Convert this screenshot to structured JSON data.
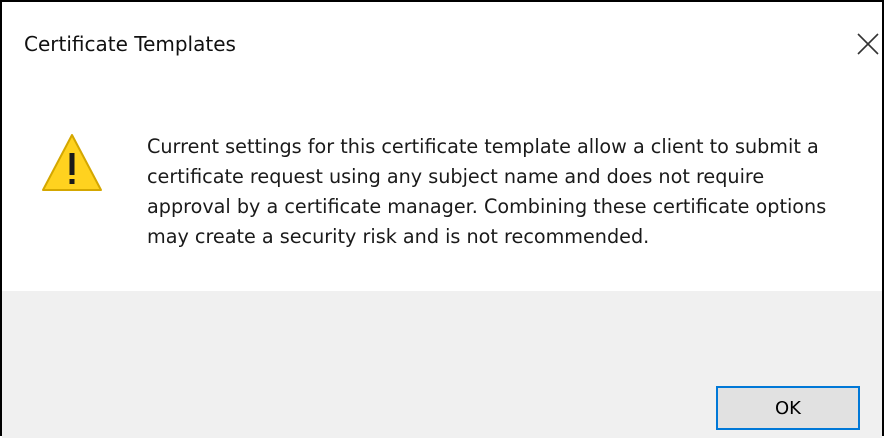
{
  "dialog": {
    "title": "Certificate Templates",
    "close_icon": "close-icon",
    "warning_icon": "warning-icon",
    "message": "Current settings for this certificate template allow a client to submit a certificate request using any subject name and does not require approval by a certificate manager. Combining these certificate options may create a security risk and is not recommended.",
    "ok_label": "OK"
  },
  "colors": {
    "warning_fill": "#ffd21f",
    "warning_stroke": "#d4a700",
    "button_focus_border": "#0078d7",
    "button_bg": "#e1e1e1",
    "footer_bg": "#f0f0f0"
  }
}
